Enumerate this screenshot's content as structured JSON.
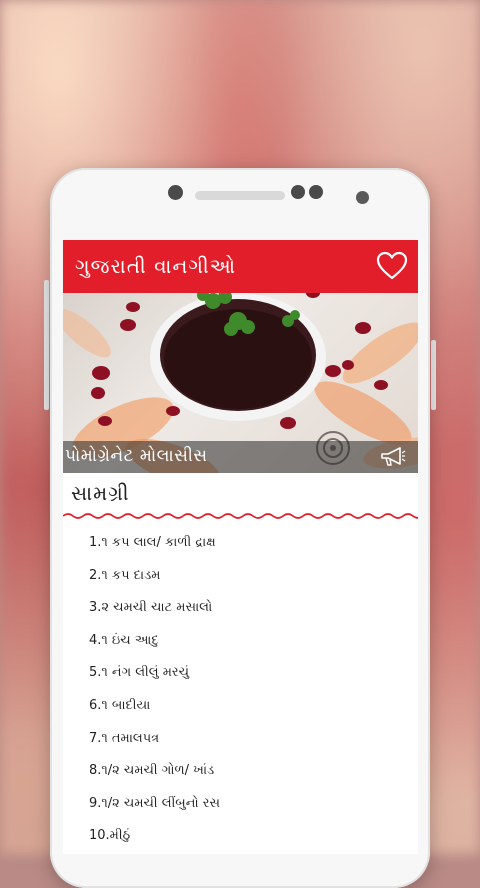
{
  "app": {
    "title": "ગુજરાતી વાનગીઓ",
    "accent_color": "#e21e2a",
    "favorite_icon": "heart-outline-icon"
  },
  "recipe": {
    "name": "પોમોગ્રેનેટ મોલાસીસ",
    "share_icon": "megaphone-icon",
    "ingredients_heading": "સામગ્રી",
    "ingredients": [
      "1.૧ કપ લાલ/ કાળી દ્રાક્ષ",
      "2.૧ કપ દાડમ",
      "3.૨ ચમચી ચાટ મસાલો",
      "4.૧ ઇંચ આદુ",
      "5.૧ નંગ લીલું મરચું",
      "6.૧ બાદીયા",
      "7.૧ તમાલપત્ર",
      "8.૧/૨ ચમચી ગોળ/ ખાંડ",
      "9.૧/૨ ચમચી લીંબુનો રસ",
      "10.મીઠું"
    ]
  }
}
